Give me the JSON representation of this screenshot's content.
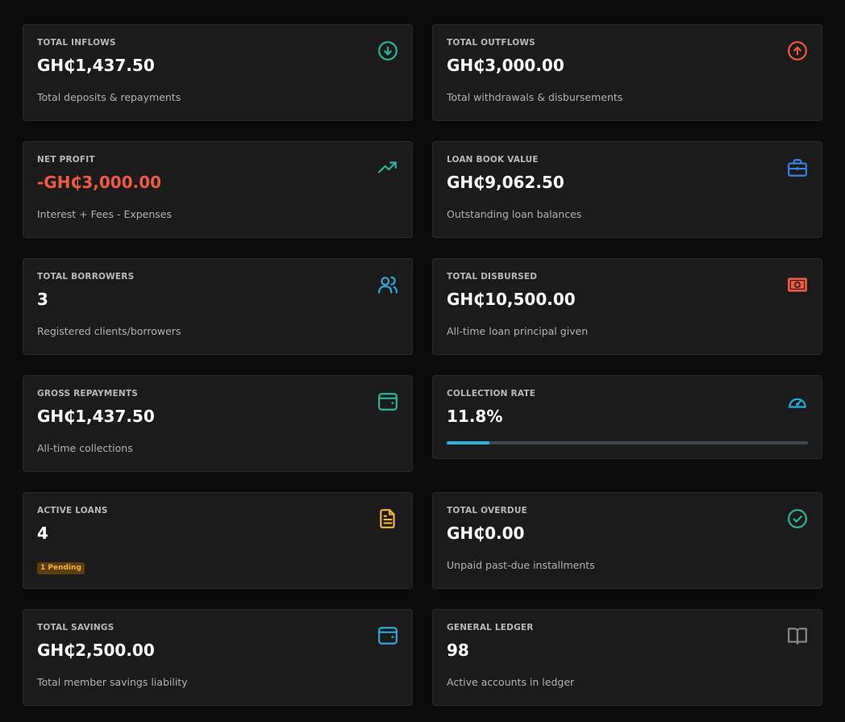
{
  "cards": {
    "total_inflows": {
      "label": "TOTAL INFLOWS",
      "value": "GH₵1,437.50",
      "sub": "Total deposits & repayments",
      "icon": "arrow-down-circle-icon",
      "icon_color": "#2fb59a"
    },
    "total_outflows": {
      "label": "TOTAL OUTFLOWS",
      "value": "GH₵3,000.00",
      "sub": "Total withdrawals & disbursements",
      "icon": "arrow-up-circle-icon",
      "icon_color": "#ef5a43"
    },
    "net_profit": {
      "label": "NET PROFIT",
      "value": "-GH₵3,000.00",
      "sub": "Interest + Fees - Expenses",
      "icon": "trending-up-icon",
      "icon_color": "#2fb59a",
      "value_color": "#ef5a43"
    },
    "loan_book_value": {
      "label": "LOAN BOOK VALUE",
      "value": "GH₵9,062.50",
      "sub": "Outstanding loan balances",
      "icon": "briefcase-icon",
      "icon_color": "#3b82e6"
    },
    "total_borrowers": {
      "label": "TOTAL BORROWERS",
      "value": "3",
      "sub": "Registered clients/borrowers",
      "icon": "users-icon",
      "icon_color": "#2fa8d8"
    },
    "total_disbursed": {
      "label": "TOTAL DISBURSED",
      "value": "GH₵10,500.00",
      "sub": "All-time loan principal given",
      "icon": "banknote-icon",
      "icon_color": "#ef5a43"
    },
    "gross_repayments": {
      "label": "GROSS REPAYMENTS",
      "value": "GH₵1,437.50",
      "sub": "All-time collections",
      "icon": "wallet-icon",
      "icon_color": "#2fb59a"
    },
    "collection_rate": {
      "label": "COLLECTION RATE",
      "value": "11.8%",
      "progress": 0.118,
      "icon": "gauge-icon",
      "icon_color": "#2fa8d8"
    },
    "active_loans": {
      "label": "ACTIVE LOANS",
      "value": "4",
      "badge": "1 Pending",
      "icon": "document-icon",
      "icon_color": "#f2b63c"
    },
    "total_overdue": {
      "label": "TOTAL OVERDUE",
      "value": "GH₵0.00",
      "sub": "Unpaid past-due installments",
      "icon": "check-circle-icon",
      "icon_color": "#2fb59a"
    },
    "total_savings": {
      "label": "TOTAL SAVINGS",
      "value": "GH₵2,500.00",
      "sub": "Total member savings liability",
      "icon": "wallet-icon",
      "icon_color": "#2fa8d8"
    },
    "general_ledger": {
      "label": "GENERAL LEDGER",
      "value": "98",
      "sub": "Active accounts in ledger",
      "icon": "book-open-icon",
      "icon_color": "#8a8a8a"
    }
  }
}
